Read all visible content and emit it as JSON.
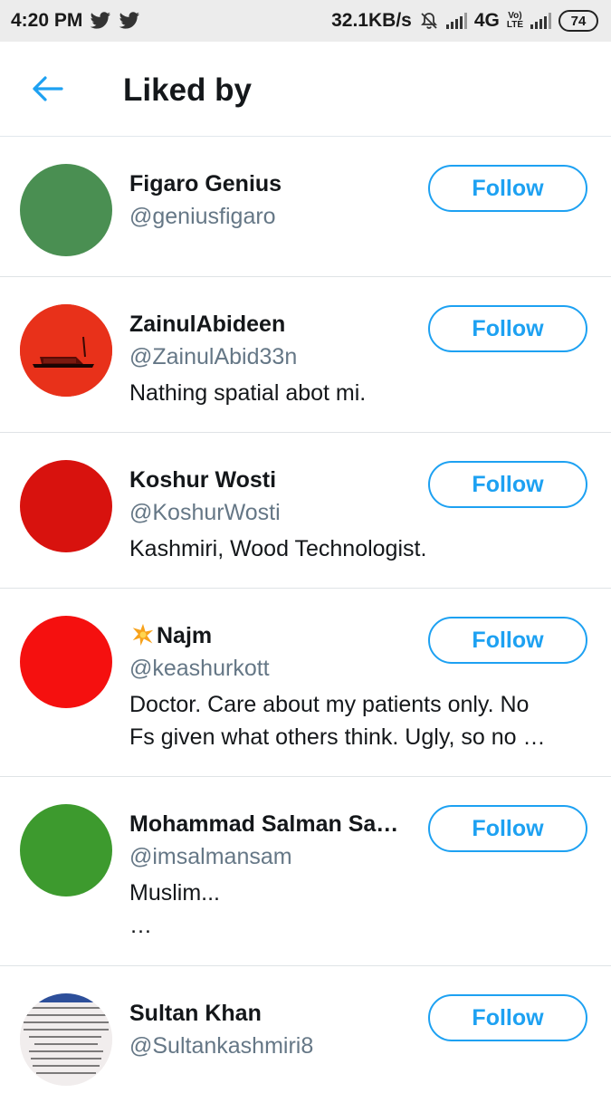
{
  "status_bar": {
    "time": "4:20 PM",
    "speed": "32.1KB/s",
    "network": "4G",
    "volte_top": "Vo)",
    "volte_bottom": "LTE",
    "battery": "74"
  },
  "header": {
    "title": "Liked by",
    "back_icon": "arrow-left-icon",
    "accent_color": "#1da1f2"
  },
  "users": [
    {
      "name": "Figaro Genius",
      "handle": "@geniusfigaro",
      "bio": "",
      "bio2": "",
      "follow_label": "Follow",
      "avatar_color": "#4a8f52"
    },
    {
      "name": "ZainulAbideen",
      "handle": "@ZainulAbid33n",
      "bio": "Nathing spatial abot mi.",
      "bio2": "",
      "follow_label": "Follow",
      "avatar_color": "#e8311a"
    },
    {
      "name": "Koshur Wosti",
      "handle": "@KoshurWosti",
      "bio": "Kashmiri, Wood Technologist.",
      "bio2": "",
      "follow_label": "Follow",
      "avatar_color": "#d8120e"
    },
    {
      "name": "Najm",
      "handle": "@keashurkott",
      "bio": "Doctor. Care about my patients only. No",
      "bio2": "Fs given what others think. Ugly, so no …",
      "follow_label": "Follow",
      "avatar_color": "#f5100f"
    },
    {
      "name": "Mohammad Salman Sa…",
      "handle": "@imsalmansam",
      "bio": "Muslim...",
      "bio2": "…",
      "follow_label": "Follow",
      "avatar_color": "#3d9a2e"
    },
    {
      "name": "Sultan Khan",
      "handle": "@Sultankashmiri8",
      "bio": "",
      "bio2": "",
      "follow_label": "Follow",
      "avatar_color": "#f3eeee"
    }
  ]
}
